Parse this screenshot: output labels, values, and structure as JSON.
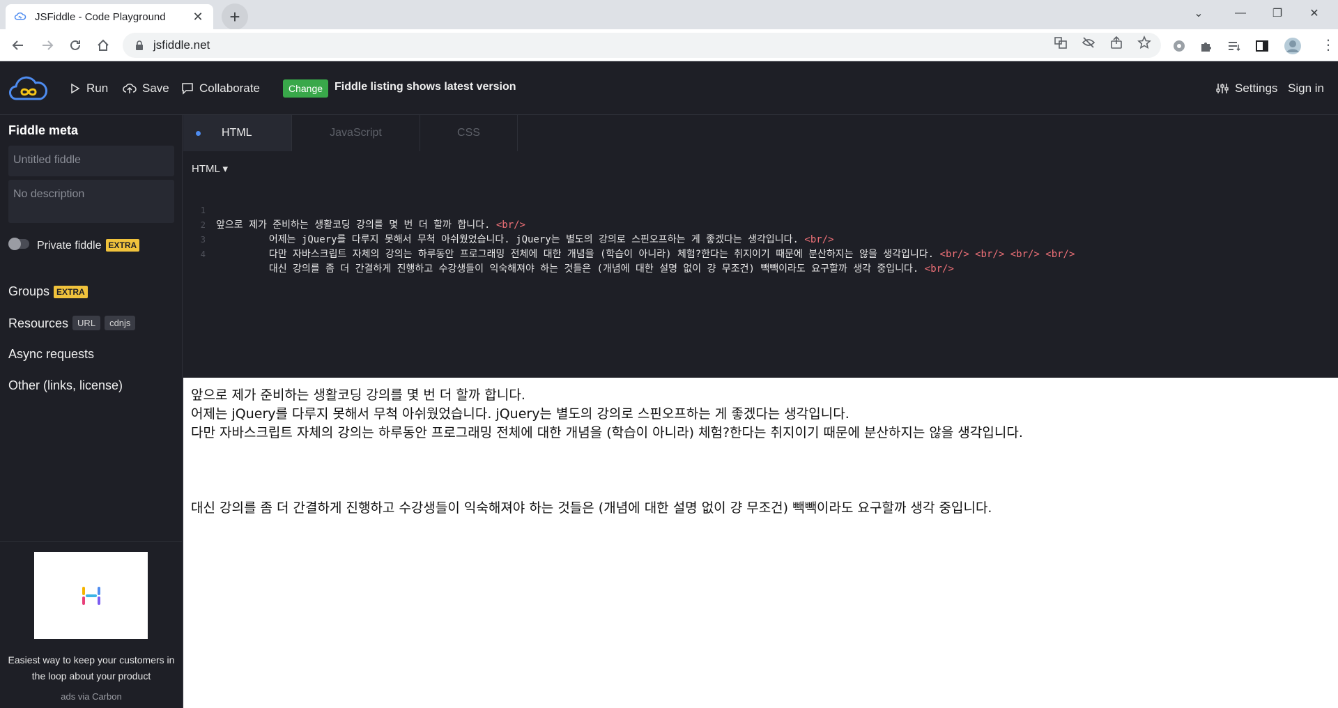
{
  "browser": {
    "tab_title": "JSFiddle - Code Playground",
    "url": "jsfiddle.net"
  },
  "header": {
    "run_label": "Run",
    "save_label": "Save",
    "collaborate_label": "Collaborate",
    "change_badge": "Change",
    "listing_text": "Fiddle listing shows latest version",
    "settings_label": "Settings",
    "signin_label": "Sign in"
  },
  "sidebar": {
    "title": "Fiddle meta",
    "title_placeholder": "Untitled fiddle",
    "description_placeholder": "No description",
    "private_label": "Private fiddle",
    "extra_badge": "EXTRA",
    "groups_label": "Groups",
    "resources_label": "Resources",
    "url_pill": "URL",
    "cdnjs_pill": "cdnjs",
    "async_label": "Async requests",
    "other_label": "Other (links, license)",
    "ad_text": "Easiest way to keep your customers in the loop about your product",
    "ad_via": "ads via Carbon"
  },
  "editor": {
    "tabs": [
      {
        "label": "HTML",
        "active": true
      },
      {
        "label": "JavaScript",
        "active": false
      },
      {
        "label": "CSS",
        "active": false
      }
    ],
    "language": "HTML",
    "lines": [
      {
        "num": "1",
        "text": "앞으로 제가 준비하는 생활코딩 강의를 몇 번 더 할까 합니다. ",
        "tags": "<br/>"
      },
      {
        "num": "2",
        "text": "         어제는 jQuery를 다루지 못해서 무척 아쉬웠었습니다. jQuery는 별도의 강의로 스핀오프하는 게 좋겠다는 생각입니다. ",
        "tags": "<br/>"
      },
      {
        "num": "3",
        "text": "         다만 자바스크립트 자체의 강의는 하루동안 프로그래밍 전체에 대한 개념을 (학습이 아니라) 체험?한다는 취지이기 때문에 분산하지는 않을 생각입니다. ",
        "tags": "<br/> <br/> <br/> <br/>"
      },
      {
        "num": "4",
        "text": "         대신 강의를 좀 더 간결하게 진행하고 수강생들이 익숙해져야 하는 것들은 (개념에 대한 설명 없이 걍 무조건) 빽빽이라도 요구할까 생각 중입니다. ",
        "tags": "<br/>"
      }
    ]
  },
  "result": {
    "lines": [
      "앞으로 제가 준비하는 생활코딩 강의를 몇 번 더 할까 합니다.",
      "어제는 jQuery를 다루지 못해서 무척 아쉬웠었습니다. jQuery는 별도의 강의로 스핀오프하는 게 좋겠다는 생각입니다.",
      "다만 자바스크립트 자체의 강의는 하루동안 프로그래밍 전체에 대한 개념을 (학습이 아니라) 체험?한다는 취지이기 때문에 분산하지는 않을 생각입니다.",
      "",
      "",
      "",
      "대신 강의를 좀 더 간결하게 진행하고 수강생들이 익숙해져야 하는 것들은 (개념에 대한 설명 없이 걍 무조건) 빽빽이라도 요구할까 생각 중입니다."
    ]
  },
  "colors": {
    "accent_green": "#39a84a",
    "extra_yellow": "#f0c23c",
    "tag_red": "#f07178",
    "logo_blue": "#4e8cf0",
    "logo_yellow": "#f5c518"
  }
}
